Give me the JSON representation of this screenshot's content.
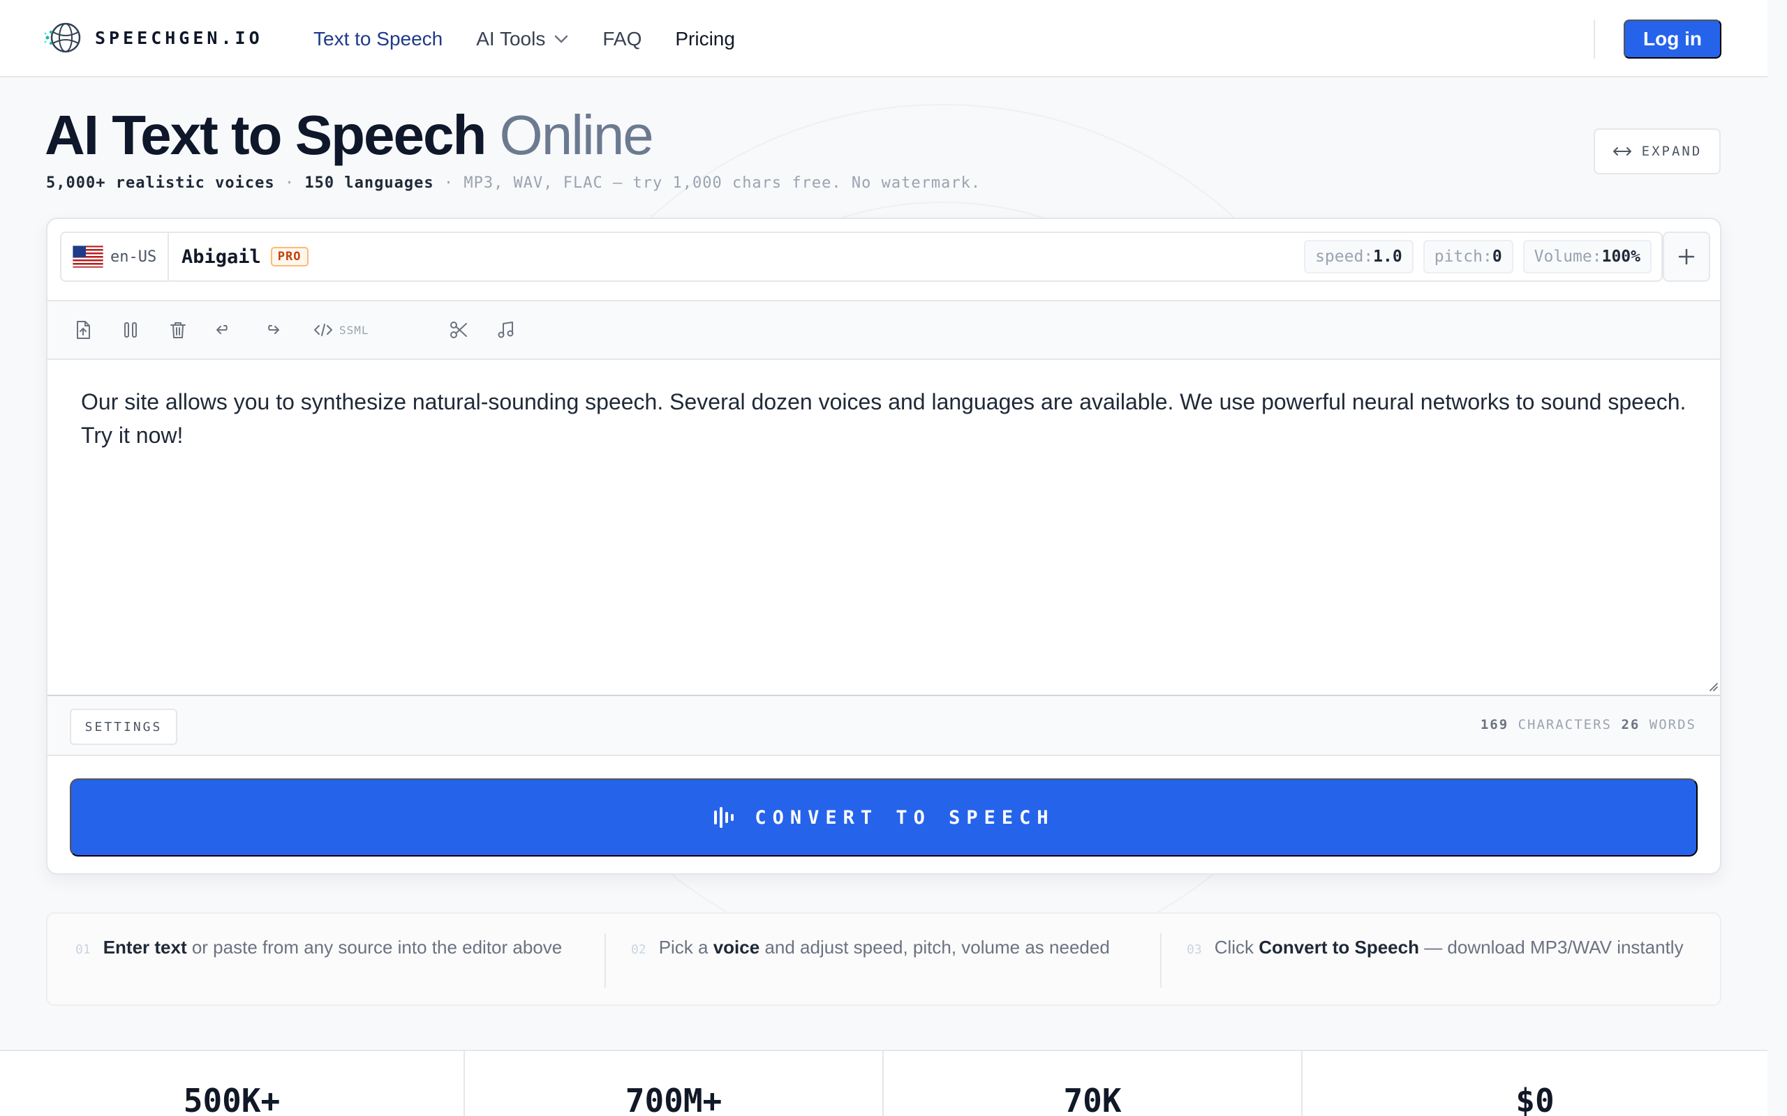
{
  "brand": {
    "name": "SPEECHGEN.IO"
  },
  "nav": {
    "items": [
      {
        "label": "Text to Speech"
      },
      {
        "label": "AI Tools"
      },
      {
        "label": "FAQ"
      },
      {
        "label": "Pricing"
      }
    ],
    "login_label": "Log in"
  },
  "hero": {
    "title_main": "AI Text to Speech",
    "title_light": "Online",
    "sub_voices": "5,000+ realistic voices",
    "sub_sep": "·",
    "sub_languages": "150 languages",
    "sub_rest": "MP3, WAV, FLAC — try 1,000 chars free. No watermark.",
    "expand_label": "EXPAND"
  },
  "editor": {
    "language_code": "en-US",
    "voice_name": "Abigail",
    "voice_badge": "PRO",
    "speed_key": "speed:",
    "speed_value": "1.0",
    "pitch_key": "pitch:",
    "pitch_value": "0",
    "volume_key": "Volume:",
    "volume_value": "100%",
    "ssml_label": "SSML",
    "text": "Our site allows you to synthesize natural-sounding speech. Several dozen voices and languages are available. We use powerful neural networks to sound speech. Try it now!",
    "settings_label": "SETTINGS",
    "char_count": "169",
    "char_label": "CHARACTERS",
    "word_count": "26",
    "word_label": "WORDS",
    "convert_label": "CONVERT TO SPEECH"
  },
  "steps": [
    {
      "num": "01",
      "bold": "Enter text",
      "rest": " or paste from any source into the editor above"
    },
    {
      "num": "02",
      "pre": "Pick a ",
      "bold": "voice",
      "rest": " and adjust speed, pitch, volume as needed"
    },
    {
      "num": "03",
      "pre": "Click ",
      "bold": "Convert to Speech",
      "rest": " — download MP3/WAV instantly"
    }
  ],
  "stats": [
    {
      "value": "500K+"
    },
    {
      "value": "700M+"
    },
    {
      "value": "70K"
    },
    {
      "value": "$0"
    }
  ],
  "colors": {
    "accent": "#2563eb",
    "nav_active": "#1e3a8a",
    "pro_badge": "#c2410c"
  }
}
